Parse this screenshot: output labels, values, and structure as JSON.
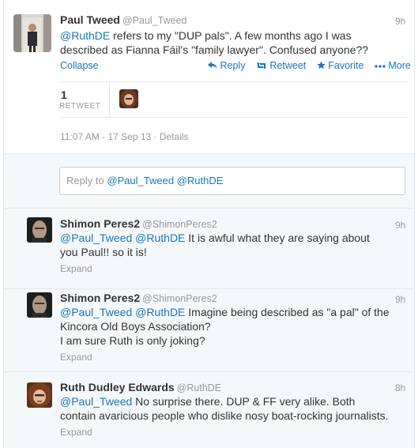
{
  "main_tweet": {
    "name": "Paul Tweed",
    "handle": "@Paul_Tweed",
    "time": "9h",
    "mention": "@RuthDE",
    "text_line1": " refers to my \"DUP pals\". A few months ago I was",
    "text_line2": "described as Fianna  Fáil's  \"family lawyer\". Confused anyone??",
    "collapse": "Collapse",
    "reply": "Reply",
    "retweet": "Retweet",
    "favorite": "Favorite",
    "more": "More",
    "retweet_count": "1",
    "retweet_label": "RETWEET",
    "details": "11:07 AM - 17 Sep 13 · Details"
  },
  "reply_box": {
    "prefix": "Reply to ",
    "mentions": "@Paul_Tweed @RuthDE"
  },
  "replies": [
    {
      "name": "Shimon Peres2",
      "handle": "@ShimonPeres2",
      "time": "9h",
      "mention": "@Paul_Tweed @RuthDE",
      "line1": "  It is awful what they are saying about",
      "line2": "you Paul!! so it is!",
      "line3": "",
      "expand": "Expand"
    },
    {
      "name": "Shimon Peres2",
      "handle": "@ShimonPeres2",
      "time": "9h",
      "mention": "@Paul_Tweed @RuthDE",
      "line1": " Imagine being described as \"a pal\" of the",
      "line2": "Kincora Old Boys Association?",
      "line3": "I am sure Ruth is only joking?",
      "expand": "Expand"
    },
    {
      "name": "Ruth Dudley Edwards",
      "handle": "@RuthDE",
      "time": "8h",
      "mention": "@Paul_Tweed",
      "line1": " No surprise there.  DUP & FF very alike.  Both",
      "line2": "contain  avaricious people who dislike nosy boat-rocking journalists.",
      "line3": "",
      "expand": "Expand"
    }
  ],
  "colors": {
    "link": "#1b76bd",
    "muted": "#999999",
    "text": "#333333",
    "reply_bg": "#f5f8fa"
  },
  "icons": [
    "reply-arrow-icon",
    "retweet-icon",
    "star-icon",
    "more-dots-icon"
  ]
}
